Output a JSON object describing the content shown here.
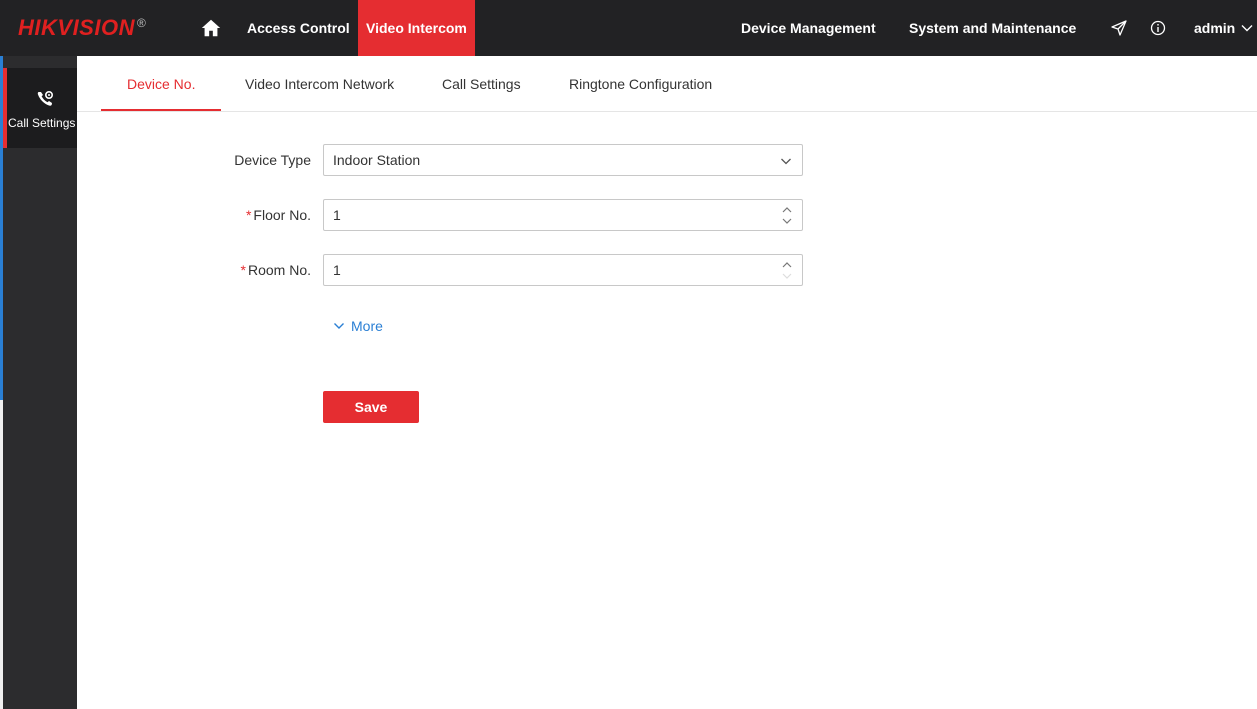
{
  "brand": {
    "name_part1": "HIK",
    "name_part2": "VISION",
    "registered": "®"
  },
  "topnav": {
    "access_control": "Access Control",
    "video_intercom": "Video Intercom",
    "device_management": "Device Management",
    "system_maintenance": "System and Maintenance",
    "user": "admin"
  },
  "sidebar": {
    "items": [
      {
        "label": "Call Settings",
        "icon": "phone-settings-icon",
        "active": true
      }
    ]
  },
  "tabs": [
    {
      "label": "Device No.",
      "active": true
    },
    {
      "label": "Video Intercom Network",
      "active": false
    },
    {
      "label": "Call Settings",
      "active": false
    },
    {
      "label": "Ringtone Configuration",
      "active": false
    }
  ],
  "form": {
    "device_type": {
      "label": "Device Type",
      "value": "Indoor Station"
    },
    "floor_no": {
      "required_mark": "*",
      "label": "Floor No.",
      "value": "1"
    },
    "room_no": {
      "required_mark": "*",
      "label": "Room No.",
      "value": "1"
    },
    "more_label": "More",
    "save_label": "Save"
  },
  "colors": {
    "accent": "#e52d31",
    "topbar": "#222224",
    "sidebar": "#2c2c2e",
    "link": "#2a7fd4"
  }
}
